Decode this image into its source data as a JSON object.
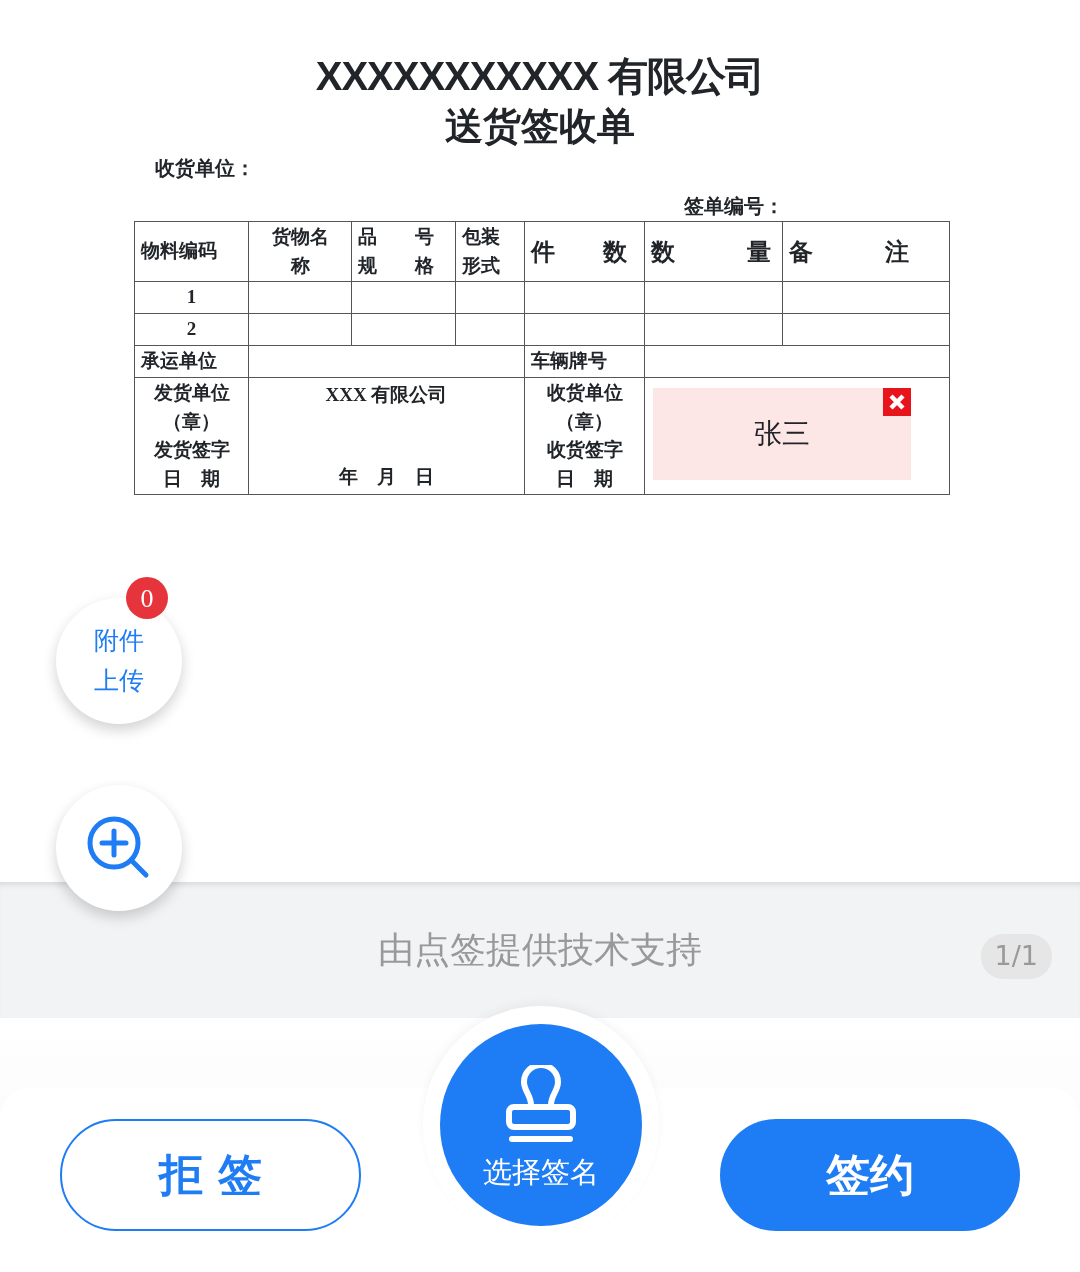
{
  "document": {
    "company_title": "XXXXXXXXXXX 有限公司",
    "title": "送货签收单",
    "consignee_label": "收货单位：",
    "doc_number_label": "签单编号：",
    "headers": [
      [
        "物料编码"
      ],
      [
        "货物名",
        "称"
      ],
      [
        "品　　号",
        "规　　格"
      ],
      [
        "包装",
        "形式"
      ],
      [
        "件　　数"
      ],
      [
        "数　　　量"
      ],
      [
        "备　　　注"
      ]
    ],
    "rows": [
      {
        "index": "1"
      },
      {
        "index": "2"
      }
    ],
    "carrier_label": "承运单位",
    "plate_label": "车辆牌号",
    "shipper_labels": [
      "发货单位",
      "（章）",
      "发货签字",
      "日　期"
    ],
    "shipper_company": "XXX 有限公司",
    "date_text": "年　月　日",
    "receiver_labels": [
      "收货单位",
      "（章）",
      "收货签字",
      "日　期"
    ],
    "signature": {
      "name": "张三"
    }
  },
  "attachment_button": {
    "lines": [
      "附件",
      "上传"
    ],
    "count": "0"
  },
  "footer": {
    "credit": "由点签提供技术支持",
    "page": "1/1"
  },
  "actions": {
    "reject": "拒 签",
    "select_signature": "选择签名",
    "sign": "签约"
  }
}
